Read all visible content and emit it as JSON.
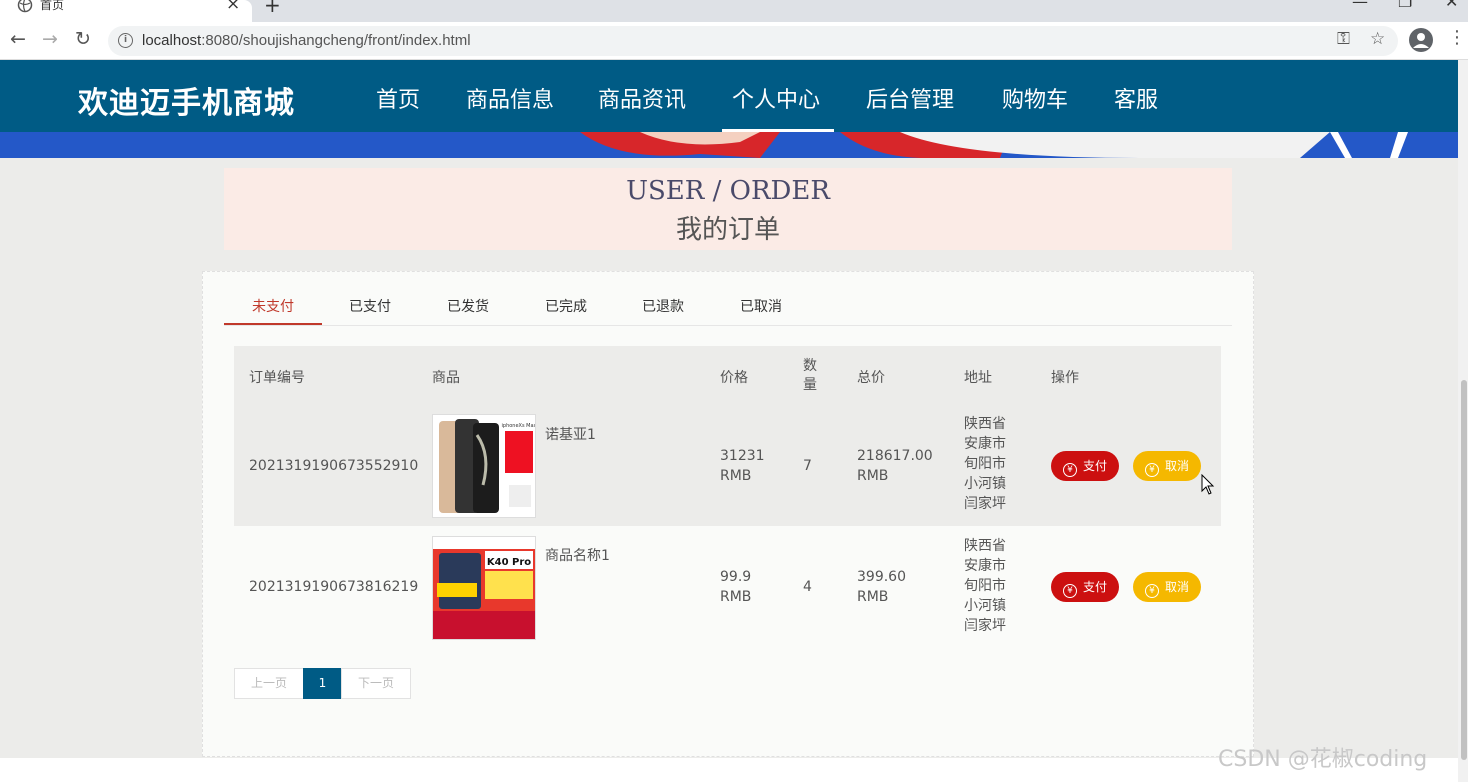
{
  "browser": {
    "tab_title": "首页",
    "tab_close": "×",
    "new_tab": "+",
    "url_host": "localhost",
    "url_path": ":8080/shoujishangcheng/front/index.html",
    "window_controls": [
      "—",
      "❐",
      "✕"
    ]
  },
  "site": {
    "logo": "欢迪迈手机商城",
    "nav": [
      "首页",
      "商品信息",
      "商品资讯",
      "个人中心",
      "后台管理",
      "购物车",
      "客服"
    ],
    "active_nav": "个人中心"
  },
  "page": {
    "title_en": "USER / ORDER",
    "title_zh": "我的订单"
  },
  "tabs": [
    "未支付",
    "已支付",
    "已发货",
    "已完成",
    "已退款",
    "已取消"
  ],
  "active_tab": "未支付",
  "table": {
    "headers": [
      "订单编号",
      "商品",
      "价格",
      "数量",
      "总价",
      "地址",
      "操作"
    ],
    "rows": [
      {
        "order_no": "2021319190673552910",
        "product": "诺基亚1",
        "price": "31231",
        "price_unit": "RMB",
        "quantity": "7",
        "total": "218617.00",
        "total_unit": "RMB",
        "address": [
          "陕西省",
          "安康市",
          "旬阳市",
          "小河镇",
          "闫家坪"
        ],
        "pay_label": "支付",
        "cancel_label": "取消"
      },
      {
        "order_no": "2021319190673816219",
        "product": "商品名称1",
        "price": "99.9",
        "price_unit": "RMB",
        "quantity": "4",
        "total": "399.60",
        "total_unit": "RMB",
        "address": [
          "陕西省",
          "安康市",
          "旬阳市",
          "小河镇",
          "闫家坪"
        ],
        "pay_label": "支付",
        "cancel_label": "取消"
      }
    ]
  },
  "pager": {
    "prev": "上一页",
    "current": "1",
    "next": "下一页"
  },
  "watermark": "CSDN @花椒coding",
  "colors": {
    "header_bg": "#005b85",
    "active_tab": "#c0392b",
    "pay_button": "#cc1010",
    "cancel_button": "#f5b800"
  }
}
